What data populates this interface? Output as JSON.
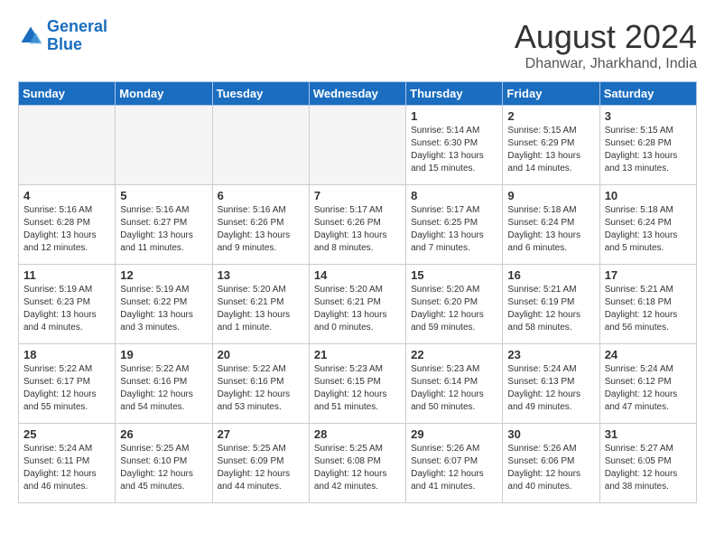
{
  "logo": {
    "line1": "General",
    "line2": "Blue"
  },
  "title": "August 2024",
  "subtitle": "Dhanwar, Jharkhand, India",
  "days_of_week": [
    "Sunday",
    "Monday",
    "Tuesday",
    "Wednesday",
    "Thursday",
    "Friday",
    "Saturday"
  ],
  "weeks": [
    [
      {
        "day": "",
        "info": ""
      },
      {
        "day": "",
        "info": ""
      },
      {
        "day": "",
        "info": ""
      },
      {
        "day": "",
        "info": ""
      },
      {
        "day": "1",
        "info": "Sunrise: 5:14 AM\nSunset: 6:30 PM\nDaylight: 13 hours\nand 15 minutes."
      },
      {
        "day": "2",
        "info": "Sunrise: 5:15 AM\nSunset: 6:29 PM\nDaylight: 13 hours\nand 14 minutes."
      },
      {
        "day": "3",
        "info": "Sunrise: 5:15 AM\nSunset: 6:28 PM\nDaylight: 13 hours\nand 13 minutes."
      }
    ],
    [
      {
        "day": "4",
        "info": "Sunrise: 5:16 AM\nSunset: 6:28 PM\nDaylight: 13 hours\nand 12 minutes."
      },
      {
        "day": "5",
        "info": "Sunrise: 5:16 AM\nSunset: 6:27 PM\nDaylight: 13 hours\nand 11 minutes."
      },
      {
        "day": "6",
        "info": "Sunrise: 5:16 AM\nSunset: 6:26 PM\nDaylight: 13 hours\nand 9 minutes."
      },
      {
        "day": "7",
        "info": "Sunrise: 5:17 AM\nSunset: 6:26 PM\nDaylight: 13 hours\nand 8 minutes."
      },
      {
        "day": "8",
        "info": "Sunrise: 5:17 AM\nSunset: 6:25 PM\nDaylight: 13 hours\nand 7 minutes."
      },
      {
        "day": "9",
        "info": "Sunrise: 5:18 AM\nSunset: 6:24 PM\nDaylight: 13 hours\nand 6 minutes."
      },
      {
        "day": "10",
        "info": "Sunrise: 5:18 AM\nSunset: 6:24 PM\nDaylight: 13 hours\nand 5 minutes."
      }
    ],
    [
      {
        "day": "11",
        "info": "Sunrise: 5:19 AM\nSunset: 6:23 PM\nDaylight: 13 hours\nand 4 minutes."
      },
      {
        "day": "12",
        "info": "Sunrise: 5:19 AM\nSunset: 6:22 PM\nDaylight: 13 hours\nand 3 minutes."
      },
      {
        "day": "13",
        "info": "Sunrise: 5:20 AM\nSunset: 6:21 PM\nDaylight: 13 hours\nand 1 minute."
      },
      {
        "day": "14",
        "info": "Sunrise: 5:20 AM\nSunset: 6:21 PM\nDaylight: 13 hours\nand 0 minutes."
      },
      {
        "day": "15",
        "info": "Sunrise: 5:20 AM\nSunset: 6:20 PM\nDaylight: 12 hours\nand 59 minutes."
      },
      {
        "day": "16",
        "info": "Sunrise: 5:21 AM\nSunset: 6:19 PM\nDaylight: 12 hours\nand 58 minutes."
      },
      {
        "day": "17",
        "info": "Sunrise: 5:21 AM\nSunset: 6:18 PM\nDaylight: 12 hours\nand 56 minutes."
      }
    ],
    [
      {
        "day": "18",
        "info": "Sunrise: 5:22 AM\nSunset: 6:17 PM\nDaylight: 12 hours\nand 55 minutes."
      },
      {
        "day": "19",
        "info": "Sunrise: 5:22 AM\nSunset: 6:16 PM\nDaylight: 12 hours\nand 54 minutes."
      },
      {
        "day": "20",
        "info": "Sunrise: 5:22 AM\nSunset: 6:16 PM\nDaylight: 12 hours\nand 53 minutes."
      },
      {
        "day": "21",
        "info": "Sunrise: 5:23 AM\nSunset: 6:15 PM\nDaylight: 12 hours\nand 51 minutes."
      },
      {
        "day": "22",
        "info": "Sunrise: 5:23 AM\nSunset: 6:14 PM\nDaylight: 12 hours\nand 50 minutes."
      },
      {
        "day": "23",
        "info": "Sunrise: 5:24 AM\nSunset: 6:13 PM\nDaylight: 12 hours\nand 49 minutes."
      },
      {
        "day": "24",
        "info": "Sunrise: 5:24 AM\nSunset: 6:12 PM\nDaylight: 12 hours\nand 47 minutes."
      }
    ],
    [
      {
        "day": "25",
        "info": "Sunrise: 5:24 AM\nSunset: 6:11 PM\nDaylight: 12 hours\nand 46 minutes."
      },
      {
        "day": "26",
        "info": "Sunrise: 5:25 AM\nSunset: 6:10 PM\nDaylight: 12 hours\nand 45 minutes."
      },
      {
        "day": "27",
        "info": "Sunrise: 5:25 AM\nSunset: 6:09 PM\nDaylight: 12 hours\nand 44 minutes."
      },
      {
        "day": "28",
        "info": "Sunrise: 5:25 AM\nSunset: 6:08 PM\nDaylight: 12 hours\nand 42 minutes."
      },
      {
        "day": "29",
        "info": "Sunrise: 5:26 AM\nSunset: 6:07 PM\nDaylight: 12 hours\nand 41 minutes."
      },
      {
        "day": "30",
        "info": "Sunrise: 5:26 AM\nSunset: 6:06 PM\nDaylight: 12 hours\nand 40 minutes."
      },
      {
        "day": "31",
        "info": "Sunrise: 5:27 AM\nSunset: 6:05 PM\nDaylight: 12 hours\nand 38 minutes."
      }
    ]
  ]
}
